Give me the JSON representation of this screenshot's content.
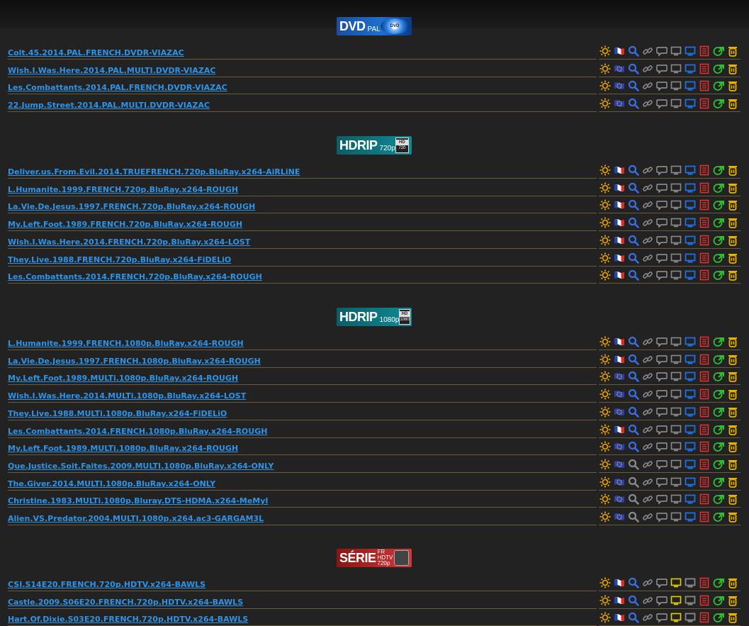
{
  "sections": [
    {
      "banner": {
        "type": "dvd",
        "main": "DVD",
        "sub": "PAL",
        "badge": "DVD"
      },
      "releases": [
        {
          "name": "Colt.45.2014.PAL.FRENCH.DVDR-VIAZAC",
          "flag": "french",
          "search": "blue",
          "screen": "grey"
        },
        {
          "name": "Wish.I.Was.Here.2014.PAL.MULTI.DVDR-VIAZAC",
          "flag": "eu",
          "search": "blue",
          "screen": "grey"
        },
        {
          "name": "Les.Combattants.2014.PAL.FRENCH.DVDR-VIAZAC",
          "flag": "eu",
          "search": "blue",
          "screen": "grey"
        },
        {
          "name": "22.Jump.Street.2014.PAL.MULTI.DVDR-VIAZAC",
          "flag": "eu",
          "search": "blue",
          "screen": "grey"
        }
      ]
    },
    {
      "banner": {
        "type": "hdrip",
        "main": "HDRIP",
        "sub": "720p",
        "hd_top": "HD",
        "hd_bottom": "720"
      },
      "releases": [
        {
          "name": "Deliver.us.From.Evil.2014.TRUEFRENCH.720p.BluRay.x264-AiRLiNE",
          "flag": "french",
          "search": "blue",
          "screen": "grey"
        },
        {
          "name": "L.Humanite.1999.FRENCH.720p.BluRay.x264-ROUGH",
          "flag": "french",
          "search": "blue",
          "screen": "grey"
        },
        {
          "name": "La.Vie.De.Jesus.1997.FRENCH.720p.BluRay.x264-ROUGH",
          "flag": "french",
          "search": "blue",
          "screen": "grey"
        },
        {
          "name": "My.Left.Foot.1989.FRENCH.720p.BluRay.x264-ROUGH",
          "flag": "french",
          "search": "blue",
          "screen": "grey"
        },
        {
          "name": "Wish.I.Was.Here.2014.FRENCH.720p.BluRay.x264-LOST",
          "flag": "french",
          "search": "blue",
          "screen": "grey"
        },
        {
          "name": "They.Live.1988.FRENCH.720p.BluRay.x264-FiDELiO",
          "flag": "french",
          "search": "blue",
          "screen": "grey"
        },
        {
          "name": "Les.Combattants.2014.FRENCH.720p.BluRay.x264-ROUGH",
          "flag": "french",
          "search": "blue",
          "screen": "grey"
        }
      ]
    },
    {
      "banner": {
        "type": "hdrip",
        "main": "HDRIP",
        "sub": "1080p",
        "hd_top": "HD",
        "hd_bottom": "1080"
      },
      "releases": [
        {
          "name": "L.Humanite.1999.FRENCH.1080p.BluRay.x264-ROUGH",
          "flag": "french",
          "search": "blue",
          "screen": "grey"
        },
        {
          "name": "La.Vie.De.Jesus.1997.FRENCH.1080p.BluRay.x264-ROUGH",
          "flag": "french",
          "search": "blue",
          "screen": "grey"
        },
        {
          "name": "My.Left.Foot.1989.MULTi.1080p.BluRay.x264-ROUGH",
          "flag": "eu",
          "search": "blue",
          "screen": "grey"
        },
        {
          "name": "Wish.I.Was.Here.2014.MULTi.1080p.BluRay.x264-LOST",
          "flag": "eu",
          "search": "blue",
          "screen": "grey"
        },
        {
          "name": "They.Live.1988.MULTi.1080p.BluRay.x264-FiDELiO",
          "flag": "eu",
          "search": "blue",
          "screen": "grey"
        },
        {
          "name": "Les.Combattants.2014.FRENCH.1080p.BluRay.x264-ROUGH",
          "flag": "french",
          "search": "blue",
          "screen": "grey"
        },
        {
          "name": "My.Left.Foot.1989.MULTi.1080p.BluRay.x264-ROUGH",
          "flag": "eu",
          "search": "blue",
          "screen": "grey"
        },
        {
          "name": "Que.Justice.Soit.Faites.2009.MULTI.1080p.BluRay.x264-ONLY",
          "flag": "eu",
          "search": "grey",
          "screen": "grey"
        },
        {
          "name": "The.Giver.2014.MULTI.1080p.BluRay.x264-ONLY",
          "flag": "eu",
          "search": "grey",
          "screen": "grey"
        },
        {
          "name": "Christine.1983.MULTi.1080p.Bluray.DTS-HDMA.x264-MeMyI",
          "flag": "eu",
          "search": "grey",
          "screen": "grey"
        },
        {
          "name": "Alien.VS.Predator.2004.MULTI.1080p.x264.ac3-GARGAM3L",
          "flag": "eu",
          "search": "grey",
          "screen": "grey"
        }
      ]
    },
    {
      "banner": {
        "type": "serie",
        "main": "SÉRIE",
        "sub_top": "FR HDTV",
        "sub": "720p"
      },
      "releases": [
        {
          "name": "CSI.S14E20.FRENCH.720p.HDTV.x264-BAWLS",
          "flag": "french",
          "search": "blue",
          "screen": "yellow"
        },
        {
          "name": "Castle.2009.S06E20.FRENCH.720p.HDTV.x264-BAWLS",
          "flag": "french",
          "search": "blue",
          "screen": "yellow"
        },
        {
          "name": "Hart.Of.Dixie.S03E20.FRENCH.720p.HDTV.x264-BAWLS",
          "flag": "french",
          "search": "blue",
          "screen": "yellow"
        }
      ]
    }
  ],
  "icon_names": [
    "sun-icon",
    "flag-icon",
    "search-icon",
    "link-icon",
    "comment-icon",
    "screen-icon",
    "monitor-icon",
    "nfo-icon",
    "share-icon",
    "trash-icon"
  ],
  "colors": {
    "background": "#222222",
    "link": "#2d94e8",
    "row_border": "#6b5a3a",
    "sun": "#f2a600",
    "search_blue": "#3b6fe0",
    "monitor_blue": "#1f6fe0",
    "nfo_red": "#e03030",
    "share_green": "#2fbf2f",
    "trash_yellow": "#e8b300"
  }
}
